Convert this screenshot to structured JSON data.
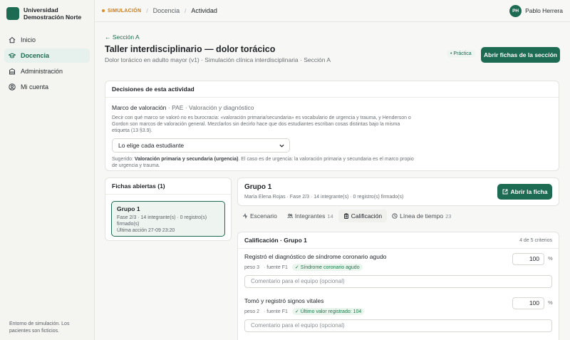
{
  "brand": {
    "name_line1": "Universidad",
    "name_line2": "Demostración Norte"
  },
  "sidebar": {
    "items": [
      {
        "label": "Inicio",
        "icon": "home-icon"
      },
      {
        "label": "Docencia",
        "icon": "graduation-cap-icon",
        "active": true
      },
      {
        "label": "Administración",
        "icon": "building-icon"
      },
      {
        "label": "Mi cuenta",
        "icon": "user-circle-icon"
      }
    ],
    "footer": "Entorno de simulación. Los pacientes son ficticios."
  },
  "topbar": {
    "sim_label": "SIMULACIÓN",
    "crumb1": "Docencia",
    "crumb2": "Actividad",
    "user_initials": "PH",
    "user_name": "Pablo Herrera"
  },
  "page": {
    "back_label": "← Sección A",
    "title": "Taller interdisciplinario — dolor torácico",
    "subtitle": "Dolor torácico en adulto mayor (v1) · Simulación clínica interdisciplinaria · Sección A",
    "mode_badge": "• Práctica",
    "open_section_button": "Abrir fichas de la sección"
  },
  "decisiones": {
    "heading": "Decisiones de esta actividad",
    "label_main": "Marco de valoración",
    "label_muted": " · PAE · Valoración y diagnóstico",
    "description": "Decir con qué marco se valoró no es burocracia: «valoración primaria/secundaria» es vocabulario de urgencia y trauma, y Henderson o Gordon son marcos de valoración general. Mezclarlos sin decirlo hace que dos estudiantes escriban cosas distintas bajo la misma etiqueta (13 §3.9).",
    "select_value": "Lo elige cada estudiante",
    "hint_prefix": "Sugerido: ",
    "hint_bold": "Valoración primaria y secundaria (urgencia)",
    "hint_rest": ". El caso es de urgencia: la valoración primaria y secundaria es el marco propio de urgencia y trauma."
  },
  "fichas": {
    "heading": "Fichas abiertas (1)",
    "item_name": "Grupo 1",
    "item_meta1": "Fase 2/3 · 14 integrante(s) · 0 registro(s) firmado(s)",
    "item_meta2": "Última acción 27-09 23:20"
  },
  "grupo": {
    "title": "Grupo 1",
    "meta": "María Elena Rojas · Fase  2/3 · 14 integrante(s) · 0 registro(s) firmado(s)",
    "open_button": "Abrir la ficha"
  },
  "tabs": [
    {
      "label": "Escenario",
      "count": "",
      "icon": "scenario-icon"
    },
    {
      "label": "Integrantes",
      "count": "14",
      "icon": "users-icon"
    },
    {
      "label": "Calificación",
      "count": "",
      "icon": "clipboard-icon",
      "active": true
    },
    {
      "label": "Línea de tiempo",
      "count": "23",
      "icon": "clock-icon"
    }
  ],
  "calificacion": {
    "heading": "Calificación · Grupo 1",
    "criteria_count": "4 de 5 criterios",
    "criterios": [
      {
        "title": "Registró el diagnóstico de síndrome coronario agudo",
        "peso": "peso 3",
        "fuente": "· fuente F1",
        "badge": "✓ Síndrome coronario agudo",
        "score": "100",
        "unit": "%",
        "comment_placeholder": "Comentario para el equipo (opcional)"
      },
      {
        "title": "Tomó y registró signos vitales",
        "peso": "peso 2",
        "fuente": "· fuente F1",
        "badge": "✓ Último valor registrado: 104",
        "score": "100",
        "unit": "%",
        "comment_placeholder": "Comentario para el equipo (opcional)"
      }
    ]
  },
  "colors": {
    "accent": "#1c6b52",
    "sim": "#e08a23"
  }
}
